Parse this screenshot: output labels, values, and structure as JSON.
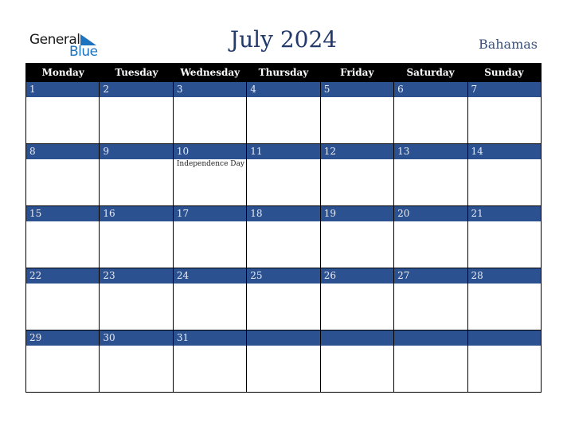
{
  "logo": {
    "general": "General",
    "blue": "Blue"
  },
  "title": "July 2024",
  "country": "Bahamas",
  "colors": {
    "band": "#2c5191",
    "header": "#000000",
    "title": "#233a6b"
  },
  "weekdays": [
    "Monday",
    "Tuesday",
    "Wednesday",
    "Thursday",
    "Friday",
    "Saturday",
    "Sunday"
  ],
  "weeks": [
    [
      {
        "day": "1"
      },
      {
        "day": "2"
      },
      {
        "day": "3"
      },
      {
        "day": "4"
      },
      {
        "day": "5"
      },
      {
        "day": "6"
      },
      {
        "day": "7"
      }
    ],
    [
      {
        "day": "8"
      },
      {
        "day": "9"
      },
      {
        "day": "10",
        "event": "Independence Day"
      },
      {
        "day": "11"
      },
      {
        "day": "12"
      },
      {
        "day": "13"
      },
      {
        "day": "14"
      }
    ],
    [
      {
        "day": "15"
      },
      {
        "day": "16"
      },
      {
        "day": "17"
      },
      {
        "day": "18"
      },
      {
        "day": "19"
      },
      {
        "day": "20"
      },
      {
        "day": "21"
      }
    ],
    [
      {
        "day": "22"
      },
      {
        "day": "23"
      },
      {
        "day": "24"
      },
      {
        "day": "25"
      },
      {
        "day": "26"
      },
      {
        "day": "27"
      },
      {
        "day": "28"
      }
    ],
    [
      {
        "day": "29"
      },
      {
        "day": "30"
      },
      {
        "day": "31"
      },
      {
        "day": ""
      },
      {
        "day": ""
      },
      {
        "day": ""
      },
      {
        "day": ""
      }
    ]
  ]
}
